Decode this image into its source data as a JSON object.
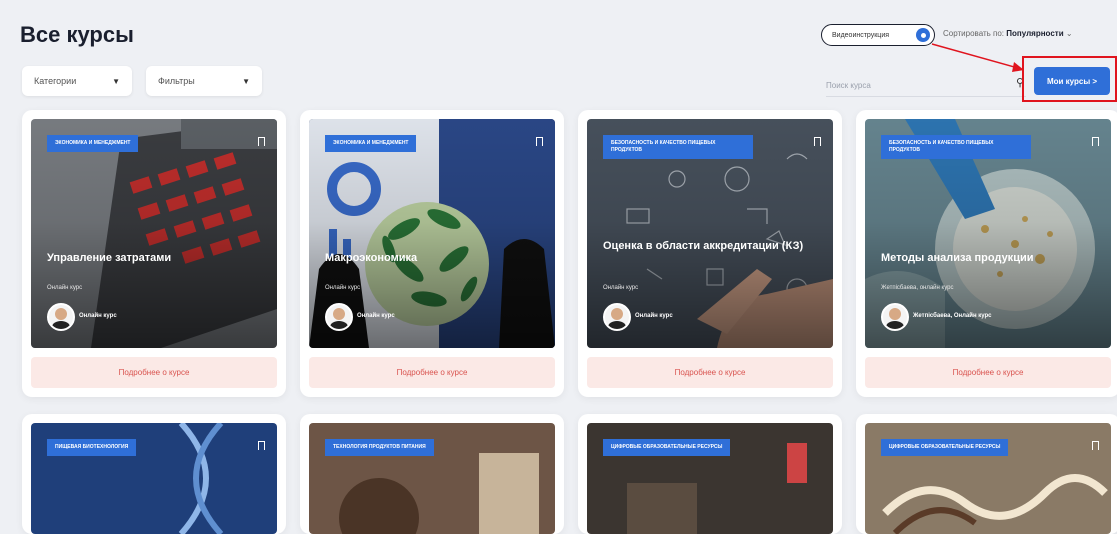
{
  "page": {
    "title": "Все курсы"
  },
  "filters": {
    "category": "Категории",
    "filters": "Фильтры"
  },
  "toolbar": {
    "toggle_label": "Видеоинструкция",
    "sort_label": "Сортировать по:",
    "sort_value": "Популярности",
    "search_placeholder": "Поиск курса",
    "my_courses": "Мои курсы >"
  },
  "more_label": "Подробнее о курсе",
  "courses": [
    {
      "category": "Экономика и менеджмент",
      "title": "Управление затратами",
      "type": "Онлайн курс",
      "author": "Онлайн курс"
    },
    {
      "category": "Экономика и менеджмент",
      "title": "Макроэкономика",
      "type": "Онлайн курс",
      "author": "Онлайн курс"
    },
    {
      "category": "Безопасность и качество пищевых продуктов",
      "title": "Оценка в области аккредитации (КЗ)",
      "type": "Онлайн курс",
      "author": "Онлайн курс"
    },
    {
      "category": "Безопасность и качество пищевых продуктов",
      "title": "Методы анализа продукции",
      "type": "Жетпісбаева, онлайн курс",
      "author": "Жетпісбаева, Онлайн курс"
    },
    {
      "category": "Пищевая биотехнология"
    },
    {
      "category": "Технология продуктов питания"
    },
    {
      "category": "Цифровые образовательные ресурсы"
    },
    {
      "category": "Цифровые образовательные ресурсы"
    }
  ],
  "colors": {
    "accent": "#2f6fd8",
    "highlight": "#e0141e",
    "more_bg": "#fbe9e6"
  }
}
